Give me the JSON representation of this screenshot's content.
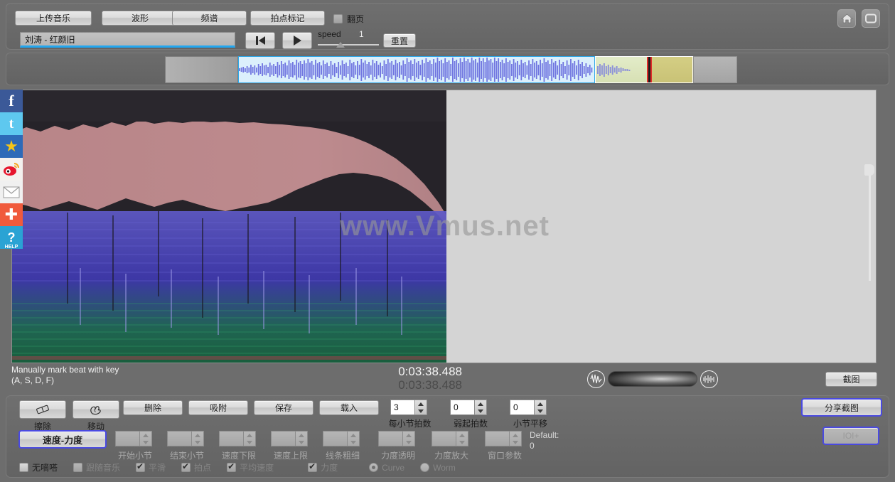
{
  "app": {
    "watermark": "www.Vmus.net"
  },
  "toolbar": {
    "tabs": [
      {
        "id": "upload",
        "label": "上传音乐"
      },
      {
        "id": "wave",
        "label": "波形"
      },
      {
        "id": "spectrum",
        "label": "频谱"
      },
      {
        "id": "beat",
        "label": "拍点标记"
      }
    ],
    "page_turn": {
      "label": "翻页",
      "checked": false
    },
    "song_title": "刘涛 - 红颜旧",
    "speed": {
      "label": "speed",
      "value": "1"
    },
    "reset_label": "重置",
    "icons": {
      "home": "home-icon",
      "fullscreen": "fullscreen-icon"
    }
  },
  "status": {
    "hint_line1": "Manually mark beat with key",
    "hint_line2": "(A, S, D, F)",
    "time_current": "0:03:38.488",
    "time_total": "0:03:38.488",
    "snapshot_label": "截图"
  },
  "editor": {
    "tools": [
      {
        "id": "erase",
        "icon": "eraser-icon",
        "label": "擦除"
      },
      {
        "id": "move",
        "icon": "hand-icon",
        "label": "移动"
      }
    ],
    "actions": [
      {
        "id": "delete",
        "label": "删除"
      },
      {
        "id": "snap",
        "label": "吸附"
      },
      {
        "id": "save",
        "label": "保存"
      },
      {
        "id": "load",
        "label": "载入"
      }
    ],
    "meter_spinners": [
      {
        "id": "beats-per-bar",
        "value": "3",
        "caption": "每小节拍数",
        "disabled": false
      },
      {
        "id": "pickup-beats",
        "value": "0",
        "caption": "弱起拍数",
        "disabled": false
      },
      {
        "id": "bar-shift",
        "value": "0",
        "caption": "小节平移",
        "disabled": false
      }
    ],
    "mode_button": "速度-力度",
    "curve_spinners": [
      {
        "id": "start-bar",
        "value": "",
        "caption": "开始小节",
        "disabled": true
      },
      {
        "id": "end-bar",
        "value": "",
        "caption": "结束小节",
        "disabled": true
      },
      {
        "id": "tempo-min",
        "value": "",
        "caption": "速度下限",
        "disabled": true
      },
      {
        "id": "tempo-max",
        "value": "",
        "caption": "速度上限",
        "disabled": true
      },
      {
        "id": "line-width",
        "value": "",
        "caption": "线条粗细",
        "disabled": true
      },
      {
        "id": "dyn-opacity",
        "value": "",
        "caption": "力度透明",
        "disabled": true
      },
      {
        "id": "dyn-scale",
        "value": "",
        "caption": "力度放大",
        "disabled": true
      },
      {
        "id": "window-param",
        "value": "",
        "caption": "窗口参数",
        "disabled": true
      }
    ],
    "default_label": "Default:",
    "default_value": "0",
    "checkboxes": [
      {
        "id": "no-tick",
        "label": "无嘀嗒",
        "checked": false,
        "disabled": false
      },
      {
        "id": "follow-music",
        "label": "跟随音乐",
        "checked": false,
        "disabled": true
      },
      {
        "id": "smooth",
        "label": "平滑",
        "checked": true,
        "disabled": true
      },
      {
        "id": "beats",
        "label": "拍点",
        "checked": true,
        "disabled": true
      },
      {
        "id": "avg-tempo",
        "label": "平均速度",
        "checked": true,
        "disabled": true
      },
      {
        "id": "dynamics",
        "label": "力度",
        "checked": true,
        "disabled": true
      }
    ],
    "radios": [
      {
        "id": "curve",
        "label": "Curve",
        "selected": true
      },
      {
        "id": "worm",
        "label": "Worm",
        "selected": false
      }
    ],
    "share_label": "分享截图",
    "iol_label": "IOI+"
  },
  "social": [
    {
      "id": "facebook",
      "glyph": "f",
      "bg": "#3b5998",
      "sub": ""
    },
    {
      "id": "twitter",
      "glyph": "t",
      "bg": "#5ec8ef",
      "sub": ""
    },
    {
      "id": "qzone",
      "glyph": "★",
      "bg": "#2d6ab8",
      "sub": ""
    },
    {
      "id": "weibo",
      "glyph": "◉",
      "bg": "#e6162d",
      "sub": ""
    },
    {
      "id": "email",
      "glyph": "✉",
      "bg": "#efefef",
      "sub": ""
    },
    {
      "id": "more",
      "glyph": "✚",
      "bg": "#f05a3c",
      "sub": ""
    },
    {
      "id": "help",
      "glyph": "?",
      "bg": "#2aa3d4",
      "sub": "HELP"
    }
  ]
}
